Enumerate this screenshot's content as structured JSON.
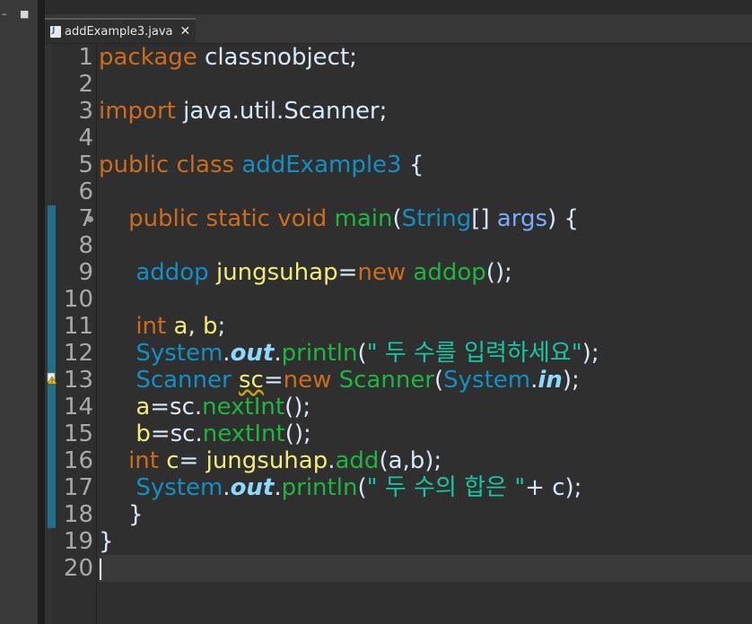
{
  "tab": {
    "title": "addExample3.java",
    "close_glyph": "✕"
  },
  "lines": [
    {
      "n": "1",
      "t": [
        [
          "kw",
          "package"
        ],
        [
          "plain",
          " classnobject;"
        ]
      ]
    },
    {
      "n": "2",
      "t": []
    },
    {
      "n": "3",
      "t": [
        [
          "kw",
          "import"
        ],
        [
          "plain",
          " java.util.Scanner;"
        ]
      ]
    },
    {
      "n": "4",
      "t": []
    },
    {
      "n": "5",
      "t": [
        [
          "kw",
          "public class "
        ],
        [
          "cls",
          "addExample3"
        ],
        [
          "plain",
          " {"
        ]
      ]
    },
    {
      "n": "6",
      "t": []
    },
    {
      "n": "7",
      "t": [
        [
          "plain",
          "    "
        ],
        [
          "kw",
          "public static void "
        ],
        [
          "fn",
          "main"
        ],
        [
          "plain",
          "("
        ],
        [
          "cls",
          "String"
        ],
        [
          "plain",
          "[] "
        ],
        [
          "param",
          "args"
        ],
        [
          "plain",
          ") {"
        ]
      ]
    },
    {
      "n": "8",
      "t": []
    },
    {
      "n": "9",
      "t": [
        [
          "plain",
          "     "
        ],
        [
          "cls",
          "addop"
        ],
        [
          "plain",
          " "
        ],
        [
          "var",
          "jungsuhap"
        ],
        [
          "plain",
          "="
        ],
        [
          "kw",
          "new"
        ],
        [
          "plain",
          " "
        ],
        [
          "fn",
          "addop"
        ],
        [
          "plain",
          "();"
        ]
      ]
    },
    {
      "n": "10",
      "t": []
    },
    {
      "n": "11",
      "t": [
        [
          "plain",
          "     "
        ],
        [
          "kw",
          "int"
        ],
        [
          "plain",
          " "
        ],
        [
          "var",
          "a"
        ],
        [
          "plain",
          ", "
        ],
        [
          "var",
          "b"
        ],
        [
          "plain",
          ";"
        ]
      ]
    },
    {
      "n": "12",
      "t": [
        [
          "plain",
          "     "
        ],
        [
          "cls",
          "System"
        ],
        [
          "plain",
          "."
        ],
        [
          "field",
          "out"
        ],
        [
          "plain",
          "."
        ],
        [
          "fn",
          "println"
        ],
        [
          "plain",
          "("
        ],
        [
          "str",
          "\" 두 수를 입력하세요\""
        ],
        [
          "plain",
          ");"
        ]
      ]
    },
    {
      "n": "13",
      "t": [
        [
          "plain",
          "     "
        ],
        [
          "cls",
          "Scanner"
        ],
        [
          "plain",
          " "
        ],
        [
          "varsq",
          "sc"
        ],
        [
          "plain",
          "="
        ],
        [
          "kw",
          "new"
        ],
        [
          "plain",
          " "
        ],
        [
          "fn",
          "Scanner"
        ],
        [
          "plain",
          "("
        ],
        [
          "cls",
          "System"
        ],
        [
          "plain",
          "."
        ],
        [
          "field",
          "in"
        ],
        [
          "plain",
          ");"
        ]
      ]
    },
    {
      "n": "14",
      "t": [
        [
          "plain",
          "     "
        ],
        [
          "var",
          "a"
        ],
        [
          "plain",
          "=sc."
        ],
        [
          "fn",
          "nextInt"
        ],
        [
          "plain",
          "();"
        ]
      ]
    },
    {
      "n": "15",
      "t": [
        [
          "plain",
          "     "
        ],
        [
          "var",
          "b"
        ],
        [
          "plain",
          "=sc."
        ],
        [
          "fn",
          "nextInt"
        ],
        [
          "plain",
          "();"
        ]
      ]
    },
    {
      "n": "16",
      "t": [
        [
          "plain",
          "    "
        ],
        [
          "kw",
          "int"
        ],
        [
          "plain",
          " "
        ],
        [
          "var",
          "c"
        ],
        [
          "plain",
          "= "
        ],
        [
          "var",
          "jungsuhap"
        ],
        [
          "plain",
          "."
        ],
        [
          "fn",
          "add"
        ],
        [
          "plain",
          "(a,b);"
        ]
      ]
    },
    {
      "n": "17",
      "t": [
        [
          "plain",
          "     "
        ],
        [
          "cls",
          "System"
        ],
        [
          "plain",
          "."
        ],
        [
          "field",
          "out"
        ],
        [
          "plain",
          "."
        ],
        [
          "fn",
          "println"
        ],
        [
          "plain",
          "("
        ],
        [
          "str",
          "\" 두 수의 합은 \""
        ],
        [
          "plain",
          "+ c);"
        ]
      ]
    },
    {
      "n": "18",
      "t": [
        [
          "plain",
          "    }"
        ]
      ]
    },
    {
      "n": "19",
      "t": [
        [
          "plain",
          "}"
        ]
      ]
    },
    {
      "n": "20",
      "t": []
    }
  ],
  "colors": {
    "keyword": "#cc6c1d",
    "class": "#1290c3",
    "method": "#1eb540",
    "variable": "#f3ec79",
    "parameter": "#79abff",
    "string": "#17c6a3",
    "field": "#8dd9ff",
    "plain": "#d9e8f7"
  },
  "icons": {
    "tab_file": "java-file-icon",
    "close": "close-icon",
    "warning": "warning-icon",
    "fold": "fold-icon"
  }
}
